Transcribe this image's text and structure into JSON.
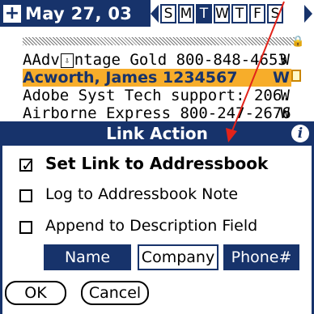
{
  "header": {
    "date": "May 27, 03",
    "days": [
      "S",
      "M",
      "T",
      "W",
      "T",
      "F",
      "S"
    ],
    "selected_day_index": 2
  },
  "entries": [
    {
      "name": "AAdv",
      "rest": "ntage Gold 800-848-4653",
      "flag": "W"
    },
    {
      "name": "Acworth, James 1234567",
      "flag": "W",
      "highlighted": true
    },
    {
      "name": "Adobe Syst  Tech support: 206...",
      "flag": "W"
    },
    {
      "name": "Airborne Express 800-247-2676",
      "flag": "W"
    }
  ],
  "dialog": {
    "title": "Link Action",
    "options": [
      {
        "label": "Set Link to Addressbook",
        "checked": true
      },
      {
        "label": "Log to Addressbook Note",
        "checked": false
      },
      {
        "label": "Append to Description Field",
        "checked": false
      }
    ],
    "fields": [
      {
        "label": "Name",
        "selected": true
      },
      {
        "label": "Company",
        "selected": false
      },
      {
        "label": "Phone#",
        "selected": true
      }
    ],
    "ok_label": "OK",
    "cancel_label": "Cancel"
  },
  "colors": {
    "navy": "#17336b",
    "highlight": "#f7ad2a",
    "annotation_arrow": "#e2231a"
  },
  "icons": [
    "plus-icon",
    "left-arrow-icon",
    "right-arrow-icon",
    "lock-icon",
    "note-icon",
    "info-icon"
  ]
}
